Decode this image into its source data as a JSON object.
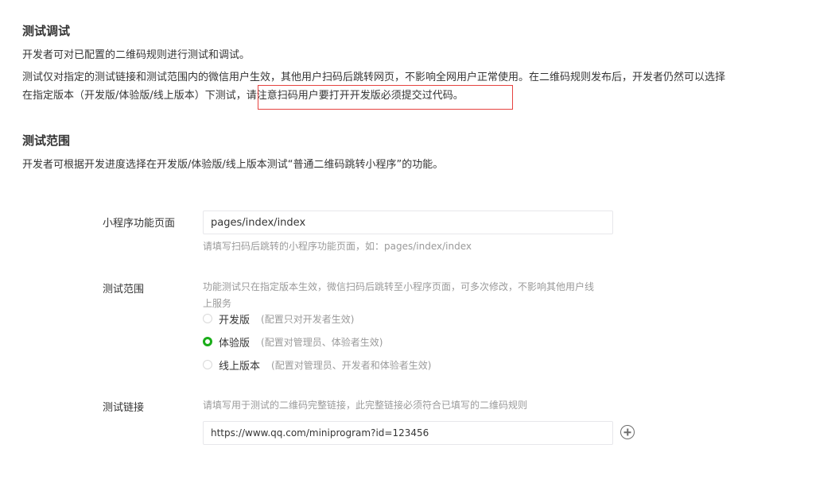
{
  "debug_section": {
    "title": "测试调试",
    "intro": "开发者可对已配置的二维码规则进行测试和调试。",
    "desc_line1": "测试仅对指定的测试链接和测试范围内的微信用户生效，其他用户扫码后跳转网页，不影响全网用户正常使用。在二维码规则发布后，开发者仍然可以选择",
    "desc_line2_prefix": "在指定版本（开发版/体验版/线上版本）下测试，",
    "desc_line2_highlight": "请注意扫码用户要打开开发版必须提交过代码。",
    "highlight_color": "#e64340"
  },
  "scope_section": {
    "title": "测试范围",
    "intro": "开发者可根据开发进度选择在开发版/体验版/线上版本测试“普通二维码跳转小程序”的功能。"
  },
  "form": {
    "page_field": {
      "label": "小程序功能页面",
      "value": "pages/index/index",
      "tip": "请填写扫码后跳转的小程序功能页面，如：pages/index/index"
    },
    "scope_field": {
      "label": "测试范围",
      "tip_line1": "功能测试只在指定版本生效，微信扫码后跳转至小程序页面，可多次修改，不影响其他用户线",
      "tip_line2": "上服务",
      "options": [
        {
          "label": "开发版",
          "desc": "(配置只对开发者生效)",
          "checked": false
        },
        {
          "label": "体验版",
          "desc": "(配置对管理员、体验者生效)",
          "checked": true
        },
        {
          "label": "线上版本",
          "desc": "(配置对管理员、开发者和体验者生效)",
          "checked": false
        }
      ],
      "accent_color": "#1aad19"
    },
    "link_field": {
      "label": "测试链接",
      "tip": "请填写用于测试的二维码完整链接，此完整链接必须符合已填写的二维码规则",
      "value": "https://www.qq.com/miniprogram?id=123456",
      "add_icon": "plus-circle-icon"
    }
  }
}
